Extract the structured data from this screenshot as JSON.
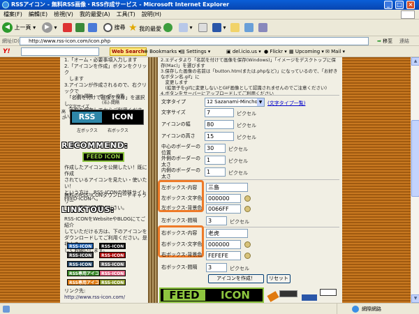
{
  "window": {
    "title": "RSSアイコン - 無料RSS画像・RSS作成サービス - Microsoft Internet Explorer"
  },
  "menu": [
    "檔案(F)",
    "編輯(E)",
    "檢視(V)",
    "我的最愛(A)",
    "工具(T)",
    "說明(H)"
  ],
  "toolbar": {
    "back": "上一頁",
    "search": "搜尋",
    "favorites": "我的最愛"
  },
  "address": {
    "label": "網址(D)",
    "url": "http://www.rss-icon.com/icon.php",
    "go": "移至",
    "links": "連結"
  },
  "ytoolbar": {
    "logo": "Y!",
    "websearch": "Web Search",
    "bookmarks": "Bookmarks",
    "settings": "Settings",
    "delicious": "del.icio.us",
    "flickr": "Flickr",
    "upcoming": "Upcoming",
    "mail": "Mail"
  },
  "left": {
    "intro_lines": [
      "1.「オーム・必要事項入力します",
      "2.「アイコンを作成」ボタンをクリック",
      "　します",
      "3.アイコンが作成されるので、右クリックで",
      "　「名前を付けて画像を保存」を選択し",
      "　画像を保存してからご利用ください。"
    ],
    "diagram": {
      "left_border": "(左)-間隔",
      "border_pos": "ボーダー位置",
      "right_border": "(右)-間隔",
      "text_size": "文字サイズ",
      "height": "高さ",
      "left_text": "RSS",
      "right_text": "ICON",
      "left_box": "左ボックス",
      "right_box": "右ボックス"
    },
    "recommend_heading": "RECOMMEND:",
    "feed_badge": "FEED ICON",
    "recommend_text": [
      "作成したアイコンを公開したい！既に作成",
      "されているアイコンを見たい・使いたい！",
      "という方は、RSS-ICONの姉妹サイト",
      "FEED-ICONへ。"
    ],
    "gallery_text": [
      "無料のRSS-ICONダウンロードギャラリー",
      "です。是非ご利用ください。"
    ],
    "linktous_heading": "LINKTOUS:",
    "linktous_text": [
      "RSS-ICONをWebsiteやBLOGにてご紹介",
      "していただける方は、下のアイコンを",
      "ダウンロードしてご利用ください。是非よろ",
      "しくお願いします。"
    ],
    "badges": [
      "RSS-ICON",
      "RSS-ICON",
      "RSS-ICON",
      "RSS-ICON",
      "RSS-ICON",
      "RSS-ICON",
      "RSS専用アイコン",
      "RSS-ICON",
      "RSS専用アイコン",
      "RSS-ICON"
    ],
    "link_label": "リンク先:",
    "link_url": "http://www.rss-icon.com/"
  },
  "right": {
    "instructions": [
      "2.エディタより「名前を付けて画像を保存(Windows)」「イメージをデスクトップに保存(Mac)」を選びます",
      "3.保存した画像の名前は「button.htm(または.phpなど)」になっているので、「お好きなボタン名.gif」に",
      "　変更します",
      "　(拡張子をgifに変更しないとGIF画像として認識されませんのでご注意ください)",
      "4.ボタンをサーバーにアップロードしてご利用ください"
    ],
    "font_type_label": "文字タイプ",
    "font_type_value": "12 Sazanami-Mincho",
    "font_list_link": "(文字タイプ一覧)",
    "rows": [
      {
        "label": "文字サイズ",
        "value": "7",
        "unit": "ピクセル"
      },
      {
        "label": "アイコンの幅",
        "value": "80",
        "unit": "ピクセル"
      },
      {
        "label": "アイコンの高さ",
        "value": "15",
        "unit": "ピクセル"
      },
      {
        "label": "中心のボーダーの位置",
        "value": "30",
        "unit": "ピクセル"
      },
      {
        "label": "外側のボーダーの太さ",
        "value": "1",
        "unit": "ピクセル"
      },
      {
        "label": "内側のボーダーの太さ",
        "value": "1",
        "unit": "ピクセル"
      }
    ],
    "left_box": {
      "content_label": "左ボックス-内容",
      "content_value": "三島",
      "text_color_label": "左ボックス-文字色",
      "text_color_value": "000000",
      "bg_color_label": "左ボックス-背景色",
      "bg_color_value": "0066FF",
      "spacing_label": "左ボックス-間隔",
      "spacing_value": "3",
      "spacing_unit": "ピクセル"
    },
    "right_box": {
      "content_label": "右ボックス-内容",
      "content_value": "老虎",
      "text_color_label": "右ボックス-文字色",
      "text_color_value": "000000",
      "bg_color_label": "右ボックス-背景色",
      "bg_color_value": "FEFEFE",
      "spacing_label": "右ボックス-間隔",
      "spacing_value": "3",
      "spacing_unit": "ピクセル"
    },
    "create_button": "アイコンを作成！",
    "reset_button": "リセット",
    "banner_left": "FEED",
    "banner_right": "ICON"
  },
  "status": {
    "zone": "網際網路"
  },
  "colors": {
    "highlight": "#ee7a28",
    "bark": "#a05a10"
  }
}
